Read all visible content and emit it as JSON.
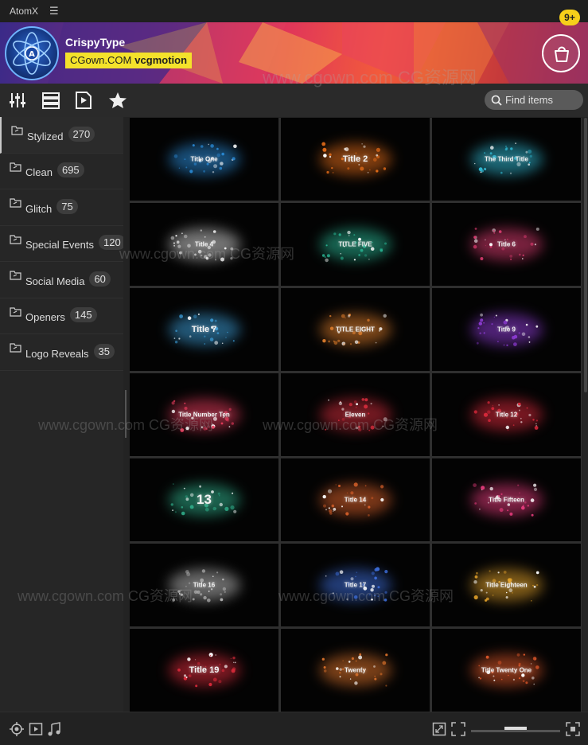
{
  "window": {
    "app_name": "AtomX",
    "menu_icon": "hamburger-icon"
  },
  "banner": {
    "brand_name": "CrispyType",
    "tag_part1": "CGown.COM",
    "tag_part2": "vcgmotion",
    "cart_badge": "9+",
    "logo_letter": "A"
  },
  "toolbar": {
    "icons": [
      "sliders-icon",
      "list-view-icon",
      "media-play-icon",
      "star-icon"
    ],
    "search_placeholder": "Find items"
  },
  "sidebar": {
    "categories": [
      {
        "label": "Stylized",
        "count": "270"
      },
      {
        "label": "Clean",
        "count": "695"
      },
      {
        "label": "Glitch",
        "count": "75"
      },
      {
        "label": "Special Events",
        "count": "120"
      },
      {
        "label": "Social Media",
        "count": "60"
      },
      {
        "label": "Openers",
        "count": "145"
      },
      {
        "label": "Logo Reveals",
        "count": "35"
      }
    ]
  },
  "grid": {
    "items": [
      {
        "title": "Title One",
        "size": "s",
        "color": "#2a8ad6"
      },
      {
        "title": "Title 2",
        "size": "m",
        "color": "#e06a18"
      },
      {
        "title": "The Third Title",
        "size": "s",
        "color": "#2fb6d0"
      },
      {
        "title": "Title 4",
        "size": "s",
        "color": "#cfcfcf"
      },
      {
        "title": "TITLE FIVE",
        "size": "s",
        "color": "#27b08f"
      },
      {
        "title": "Title 6",
        "size": "s",
        "color": "#d83a6e"
      },
      {
        "title": "Title 7",
        "size": "m",
        "color": "#3b9ad3"
      },
      {
        "title": "TITLE EIGHT",
        "size": "s",
        "color": "#d97a2a"
      },
      {
        "title": "Title 9",
        "size": "s",
        "color": "#8b3ad1"
      },
      {
        "title": "Title Number Ten",
        "size": "s",
        "color": "#e23a5a"
      },
      {
        "title": "Eleven",
        "size": "s",
        "color": "#cc2b3a"
      },
      {
        "title": "Title 12",
        "size": "s",
        "color": "#d6283a"
      },
      {
        "title": "13",
        "size": "l",
        "color": "#2fae8a"
      },
      {
        "title": "Title 14",
        "size": "s",
        "color": "#d8602a"
      },
      {
        "title": "Title Fifteen",
        "size": "s",
        "color": "#e23a7a"
      },
      {
        "title": "Title 16",
        "size": "s",
        "color": "#b8b8b8"
      },
      {
        "title": "Title 17",
        "size": "s",
        "color": "#3b6ad3"
      },
      {
        "title": "Title Eighteen",
        "size": "s",
        "color": "#e0a02a"
      },
      {
        "title": "Title 19",
        "size": "m",
        "color": "#d82a3a"
      },
      {
        "title": "Twenty",
        "size": "s",
        "color": "#d8702a"
      },
      {
        "title": "Title Twenty One",
        "size": "s",
        "color": "#e0582a"
      }
    ]
  },
  "footer": {
    "left_icons": [
      "target-icon",
      "video-icon",
      "music-icon"
    ],
    "right_icons": [
      "fit-icon",
      "expand-icon",
      "fullscreen-icon"
    ],
    "zoom_level": 0.5
  },
  "watermark": "www.cgown.com CG资源网"
}
